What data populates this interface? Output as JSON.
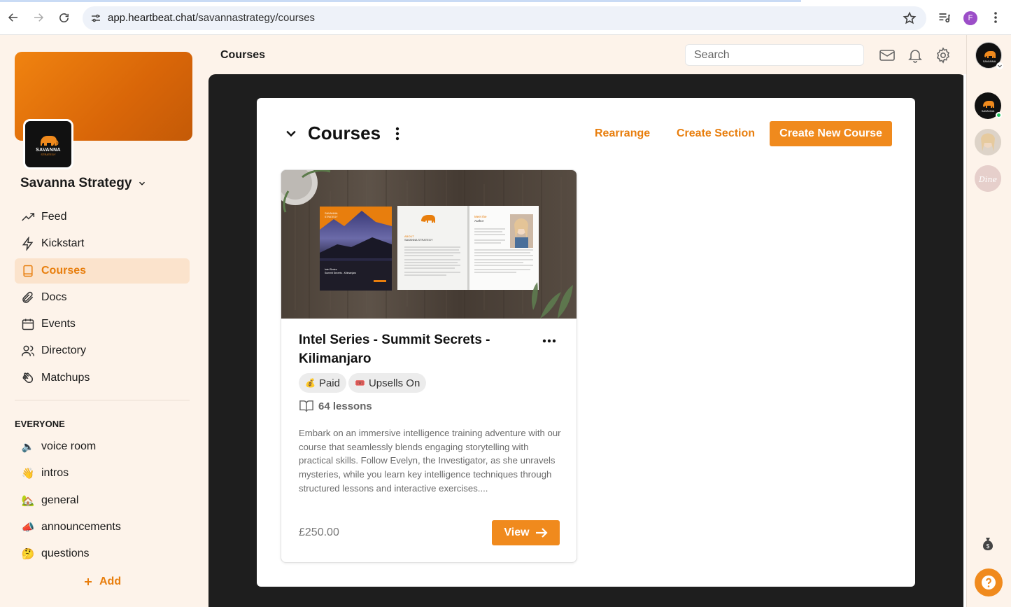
{
  "browser": {
    "url_host": "app.heartbeat.chat",
    "url_path": "/savannastrategy/courses",
    "profile_initial": "F"
  },
  "sidebar": {
    "logo_text": "SAVANNA",
    "logo_subtext": "STRATEGY",
    "community_name": "Savanna Strategy",
    "items": [
      {
        "label": "Feed",
        "icon": "trending-icon",
        "active": false
      },
      {
        "label": "Kickstart",
        "icon": "bolt-icon",
        "active": false
      },
      {
        "label": "Courses",
        "icon": "book-icon",
        "active": true
      },
      {
        "label": "Docs",
        "icon": "paperclip-icon",
        "active": false
      },
      {
        "label": "Events",
        "icon": "calendar-icon",
        "active": false
      },
      {
        "label": "Directory",
        "icon": "users-icon",
        "active": false
      },
      {
        "label": "Matchups",
        "icon": "clap-icon",
        "active": false
      }
    ],
    "section_label": "EVERYONE",
    "channels": [
      {
        "emoji": "🔈",
        "label": "voice room"
      },
      {
        "emoji": "👋",
        "label": "intros"
      },
      {
        "emoji": "🏡",
        "label": "general"
      },
      {
        "emoji": "📣",
        "label": "announcements"
      },
      {
        "emoji": "🤔",
        "label": "questions"
      }
    ],
    "add_label": "Add"
  },
  "header": {
    "title": "Courses",
    "search_placeholder": "Search"
  },
  "courses": {
    "heading": "Courses",
    "rearrange_label": "Rearrange",
    "create_section_label": "Create Section",
    "create_course_label": "Create New Course",
    "accent_color": "#f08a1d"
  },
  "course_card": {
    "title": "Intel Series - Summit Secrets - Kilimanjaro",
    "tags": [
      {
        "emoji": "💰",
        "label": "Paid"
      },
      {
        "emoji": "🎟️",
        "label": "Upsells On"
      }
    ],
    "lessons": "64 lessons",
    "description": "Embark on an immersive intelligence training adventure with our course that seamlessly blends engaging storytelling with practical skills. Follow Evelyn, the Investigator, as she unravels mysteries, while you learn key intelligence techniques through structured lessons and interactive exercises....",
    "price": "£250.00",
    "view_label": "View",
    "image_labels": {
      "book_brand": "SAVANNA STRATEGY",
      "book_series": "Intel Series",
      "book_title": "Summit Secrets - Kilimanjaro",
      "about_heading": "ABOUT",
      "about_brand": "SAVANNA STRATEGY",
      "meet_heading": "Meet the",
      "meet_sub": "Author"
    }
  }
}
